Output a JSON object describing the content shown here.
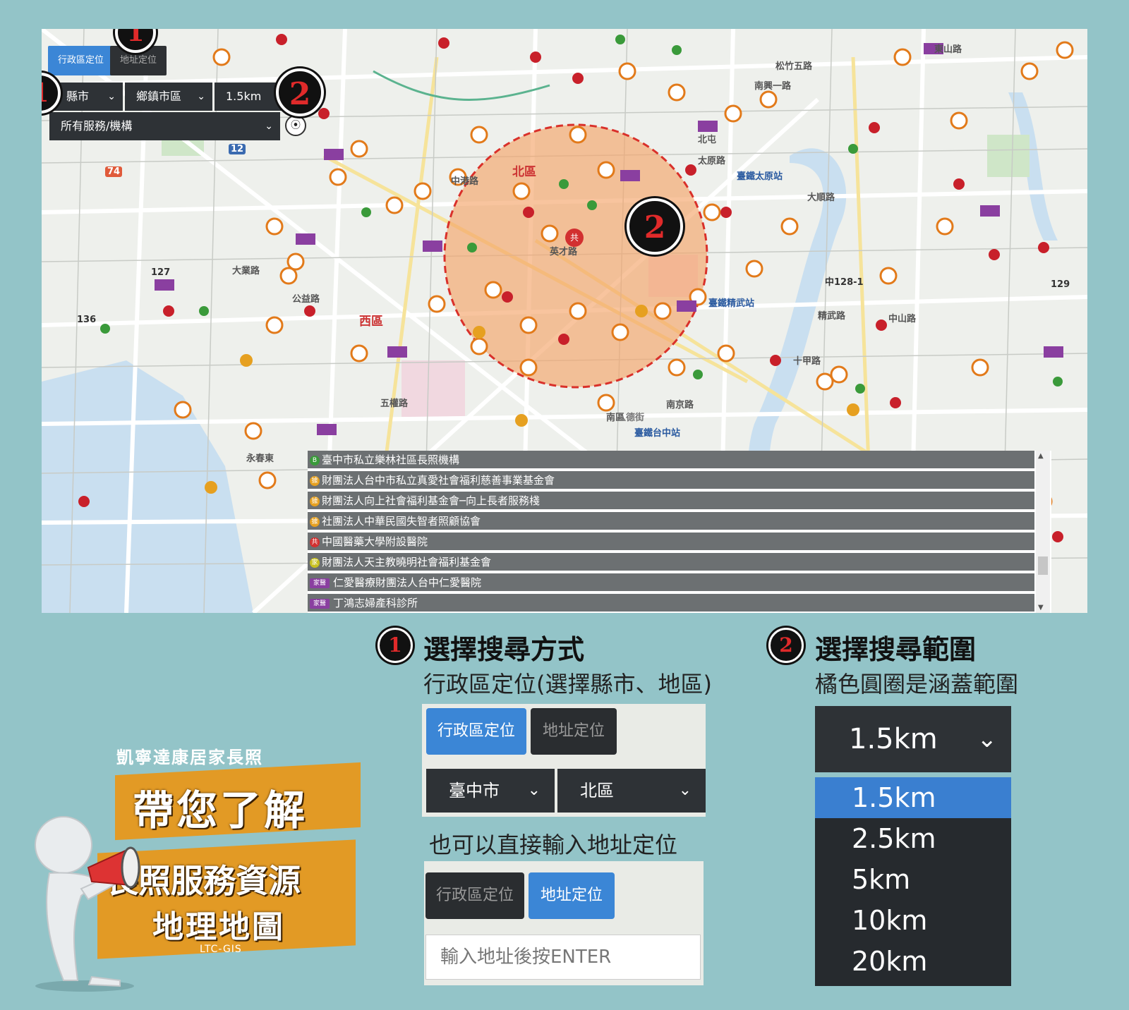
{
  "map": {
    "tabs": {
      "admin_label": "行政區定位",
      "address_label": "地址定位"
    },
    "county_select": "縣市",
    "district_select": "鄉鎮市區",
    "range_select": "1.5km",
    "service_select": "所有服務/機構",
    "center_marker": "共",
    "district_labels": [
      "北區",
      "西區",
      "南區",
      "英才路",
      "大業路",
      "五權路",
      "公益路",
      "南京路",
      "八德街",
      "太原路",
      "大順路",
      "精武路",
      "十甲路",
      "中山路",
      "松竹五路",
      "南興一路",
      "東山路",
      "北屯",
      "臺鐵太原站",
      "臺鐵精武站",
      "臺鐵台中站",
      "中港路",
      "永春東",
      "中128-1",
      "129",
      "136",
      "127",
      "74",
      "12"
    ],
    "facility_list": [
      {
        "icon": "B",
        "color": "#3a9a3a",
        "label": "臺中市私立樂林社區長照機構"
      },
      {
        "icon": "據",
        "color": "#e6a020",
        "label": "財團法人台中市私立真愛社會福利慈善事業基金會"
      },
      {
        "icon": "據",
        "color": "#e6a020",
        "label": "財團法人向上社會福利基金會─向上長者服務棧"
      },
      {
        "icon": "據",
        "color": "#e6a020",
        "label": "社團法人中華民國失智者照顧協會"
      },
      {
        "icon": "共",
        "color": "#d23030",
        "label": "中國醫藥大學附設醫院"
      },
      {
        "icon": "家",
        "color": "#c8c020",
        "label": "財團法人天主教曉明社會福利基金會"
      },
      {
        "icon": "家醫",
        "color": "#8a3fa0",
        "label": "仁愛醫療財團法人台中仁愛醫院"
      },
      {
        "icon": "家醫",
        "color": "#8a3fa0",
        "label": "丁鴻志婦產科診所"
      }
    ]
  },
  "steps": {
    "step1": {
      "num": "1",
      "title": "選擇搜尋方式",
      "desc": "行政區定位(選擇縣市、地區)",
      "alt": "也可以直接輸入地址定位"
    },
    "step2": {
      "num": "2",
      "title": "選擇搜尋範圍",
      "desc": "橘色圓圈是涵蓋範圍"
    }
  },
  "shot1": {
    "admin_label": "行政區定位",
    "address_label": "地址定位",
    "county": "臺中市",
    "district": "北區"
  },
  "shot2": {
    "admin_label": "行政區定位",
    "address_label": "地址定位",
    "placeholder": "輸入地址後按ENTER"
  },
  "range_dropdown": {
    "selected": "1.5km",
    "options": [
      "1.5km",
      "2.5km",
      "5km",
      "10km",
      "20km"
    ]
  },
  "promo": {
    "top": "凱寧達康居家長照",
    "line1": "帶您了解",
    "line2": "長照服務資源",
    "line3": "地理地圖",
    "tag": "LTC-GIS"
  },
  "colors": {
    "bg": "#93c4c8",
    "accent_blue": "#3b86d6",
    "dark": "#2e3236",
    "orange_circle": "#f4a56a",
    "badge_red": "#e02a2a",
    "ribbon": "#e29a25"
  }
}
